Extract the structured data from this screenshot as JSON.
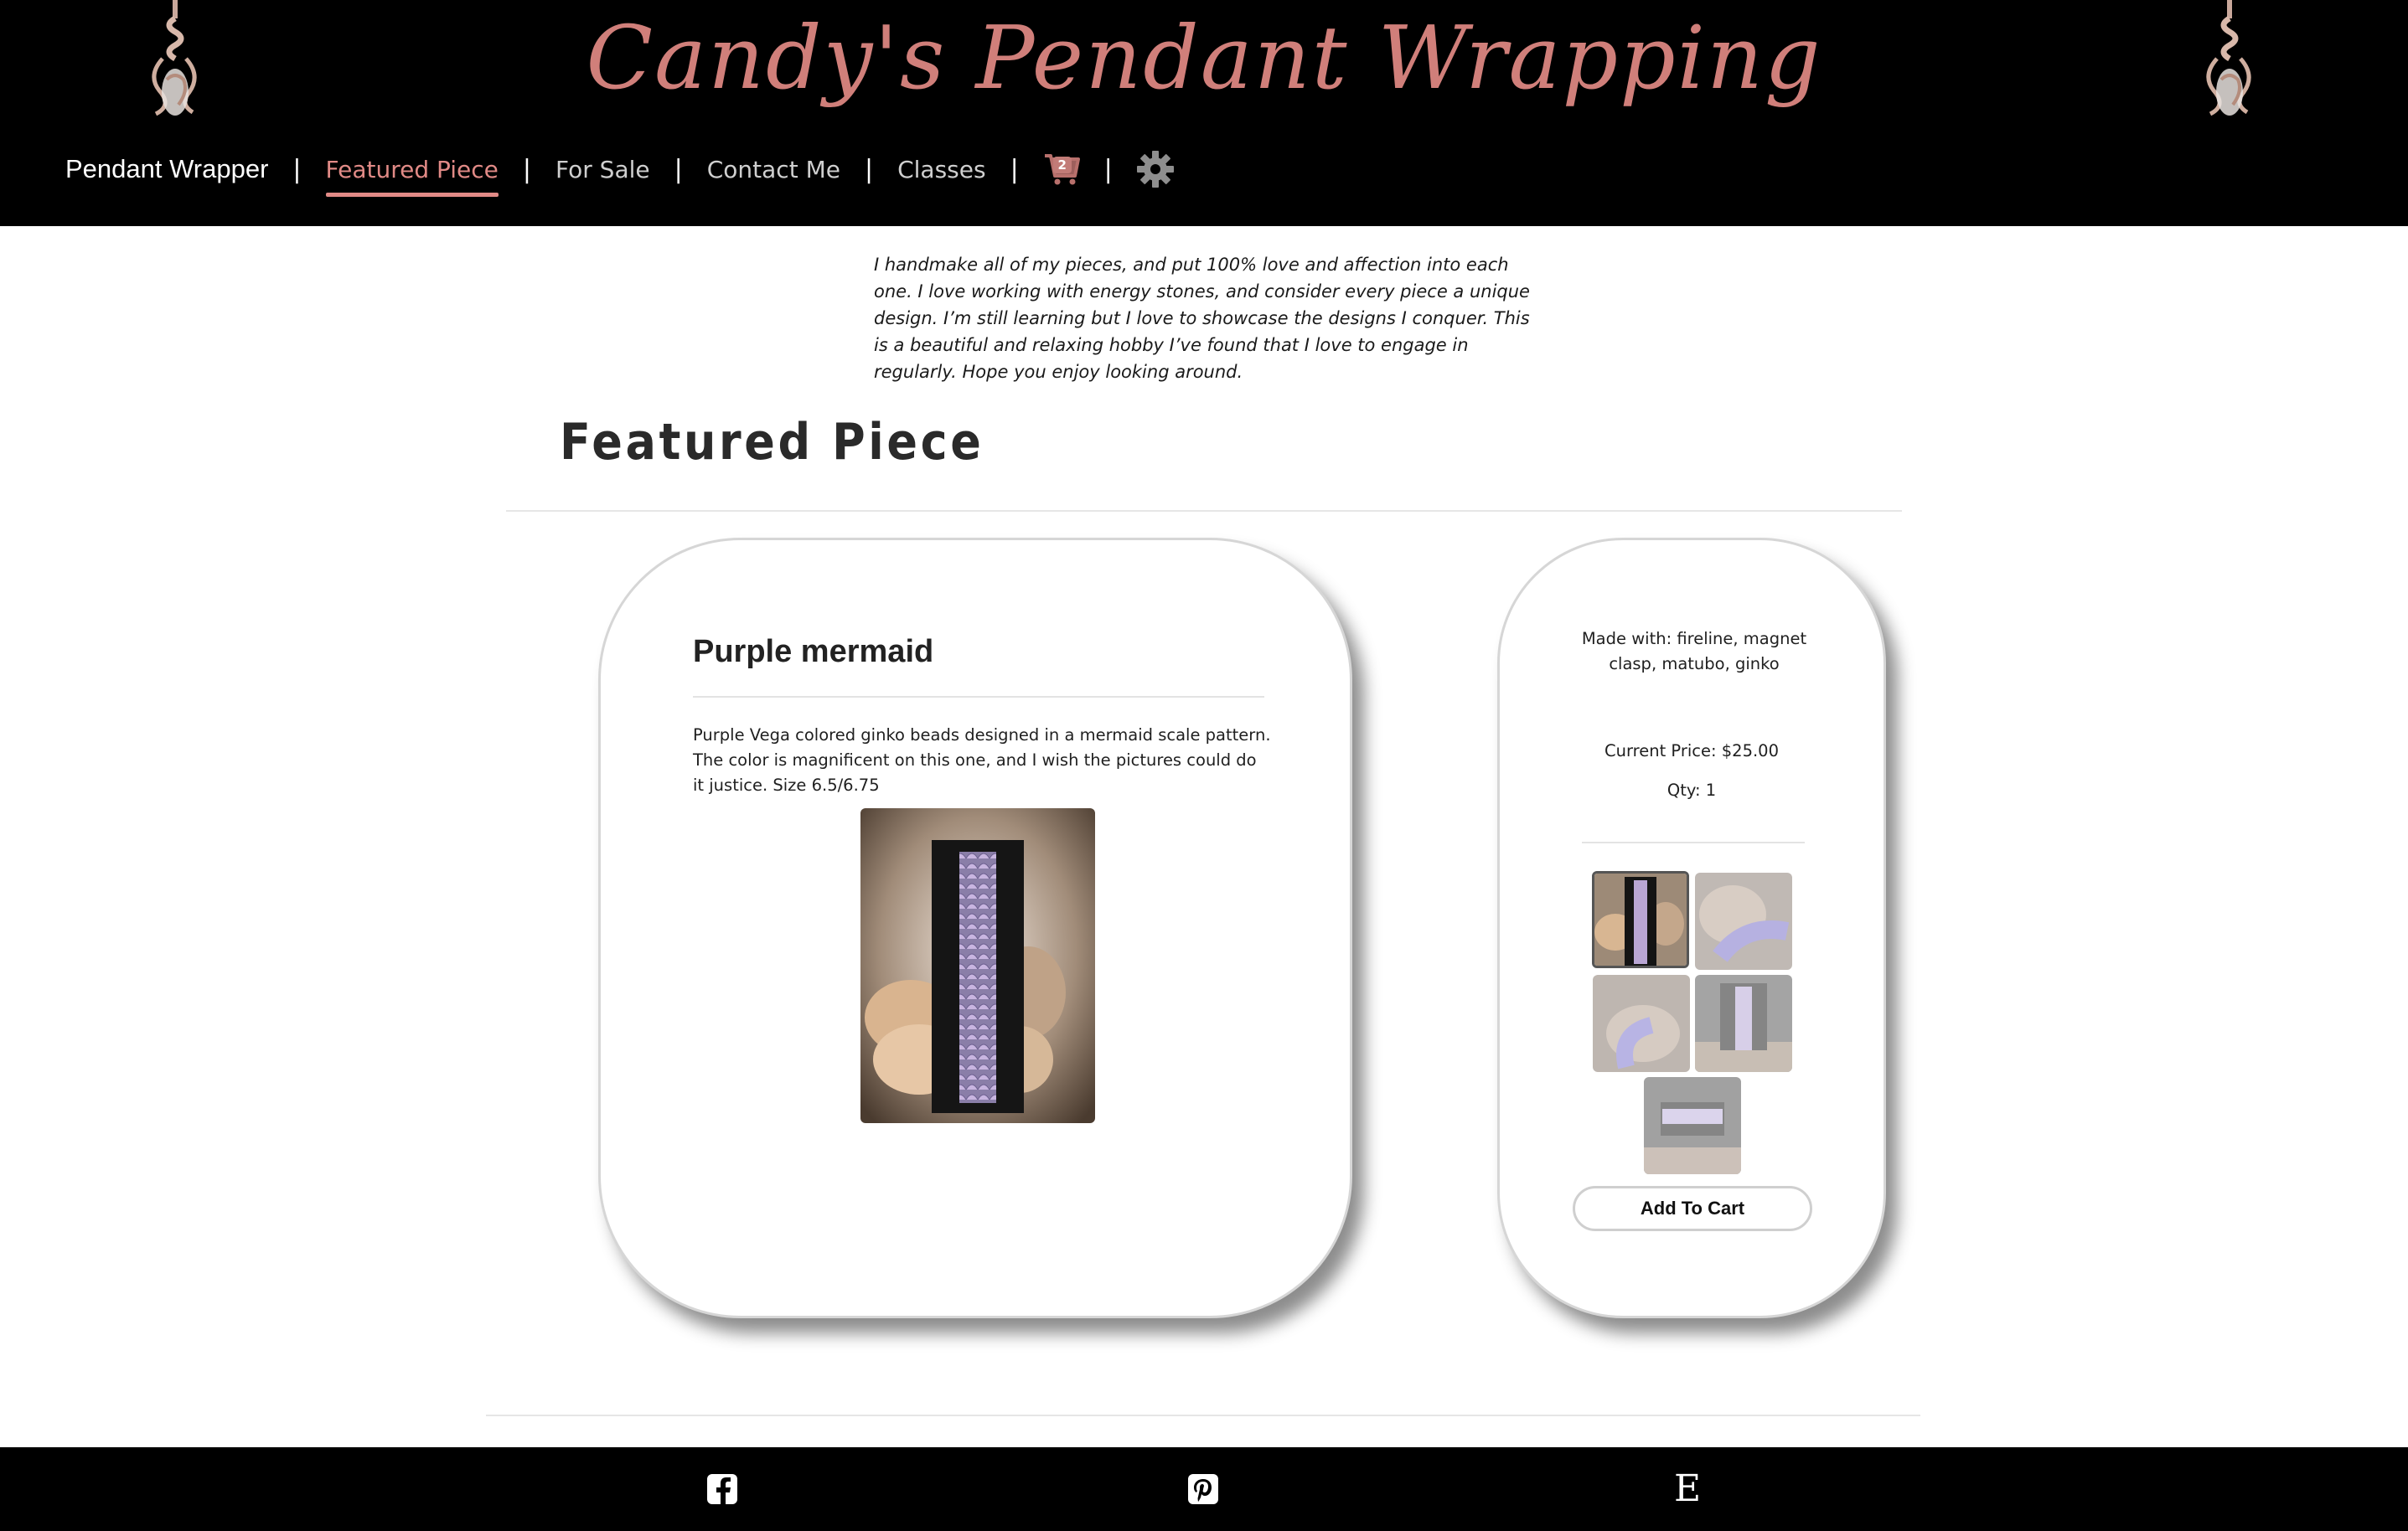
{
  "header": {
    "site_title": "Candy's Pendant Wrapping",
    "nav": {
      "brand": "Pendant Wrapper",
      "items": [
        {
          "label": "Featured Piece",
          "active": true
        },
        {
          "label": "For Sale"
        },
        {
          "label": "Contact Me"
        },
        {
          "label": "Classes"
        }
      ],
      "separator": "|",
      "cart_count": "2",
      "cart_icon": "shopping-cart-icon",
      "settings_icon": "gear-icon"
    },
    "decoration_icon": "wire-wrapped-pendant"
  },
  "intro_text": "I handmake all of my pieces, and put 100% love and affection into each one. I love working with energy stones, and consider every piece a unique design. I’m still learning but I love to showcase the designs I conquer. This is a beautiful and relaxing hobby I’ve found that I love to engage in regularly. Hope you enjoy looking around.",
  "page_title": "Featured Piece",
  "product": {
    "name": "Purple mermaid",
    "description": "Purple Vega colored ginko beads designed in a mermaid scale pattern. The color is magnificent on this one, and I wish the pictures could do it justice. Size 6.5/6.75",
    "photo": "purple mermaid bracelet on black display"
  },
  "purchase": {
    "made_with": "Made with: fireline, magnet clasp, matubo, ginko",
    "price": "Current Price: $25.00",
    "qty": "Qty: 1",
    "thumbnail_count": 5,
    "selected_thumbnail": 1,
    "add_to_cart": "Add To Cart"
  },
  "footer": {
    "social": [
      "facebook-icon",
      "pinterest-icon",
      "etsy-icon"
    ],
    "etsy_glyph": "E"
  },
  "colors": {
    "accent": "#d07f7a",
    "header_bg": "#000000"
  }
}
